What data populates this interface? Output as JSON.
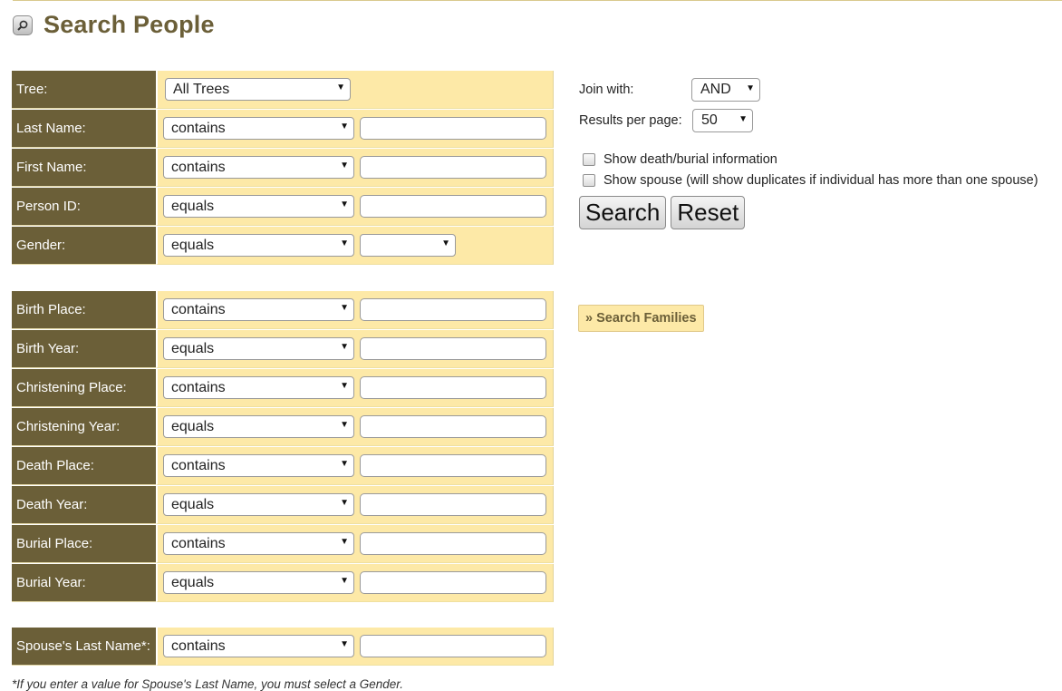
{
  "page": {
    "title": "Search People"
  },
  "group1": [
    {
      "label": "Tree:",
      "op": "All Trees",
      "kind": "tree"
    },
    {
      "label": "Last Name:",
      "op": "contains",
      "kind": "text"
    },
    {
      "label": "First Name:",
      "op": "contains",
      "kind": "text"
    },
    {
      "label": "Person ID:",
      "op": "equals",
      "kind": "text"
    },
    {
      "label": "Gender:",
      "op": "equals",
      "kind": "gender",
      "value": ""
    }
  ],
  "group2": [
    {
      "label": "Birth Place:",
      "op": "contains"
    },
    {
      "label": "Birth Year:",
      "op": "equals"
    },
    {
      "label": "Christening Place:",
      "op": "contains"
    },
    {
      "label": "Christening Year:",
      "op": "equals"
    },
    {
      "label": "Death Place:",
      "op": "contains"
    },
    {
      "label": "Death Year:",
      "op": "equals"
    },
    {
      "label": "Burial Place:",
      "op": "contains"
    },
    {
      "label": "Burial Year:",
      "op": "equals"
    }
  ],
  "group3": [
    {
      "label": "Spouse's Last Name*:",
      "op": "contains"
    }
  ],
  "options": {
    "join_label": "Join with:",
    "join_value": "AND",
    "results_label": "Results per page:",
    "results_value": "50",
    "check_death": "Show death/burial information",
    "check_spouse": "Show spouse (will show duplicates if individual has more than one spouse)",
    "search_btn": "Search",
    "reset_btn": "Reset",
    "families_link": "» Search Families"
  },
  "footnote": "*If you enter a value for Spouse's Last Name, you must select a Gender.",
  "colors": {
    "label_bg": "#6b5f38",
    "cell_bg": "#fde9a7",
    "title": "#6b5f38"
  },
  "icons": {
    "title": "magnifier-icon",
    "dropdown": "chevron-down-icon"
  }
}
